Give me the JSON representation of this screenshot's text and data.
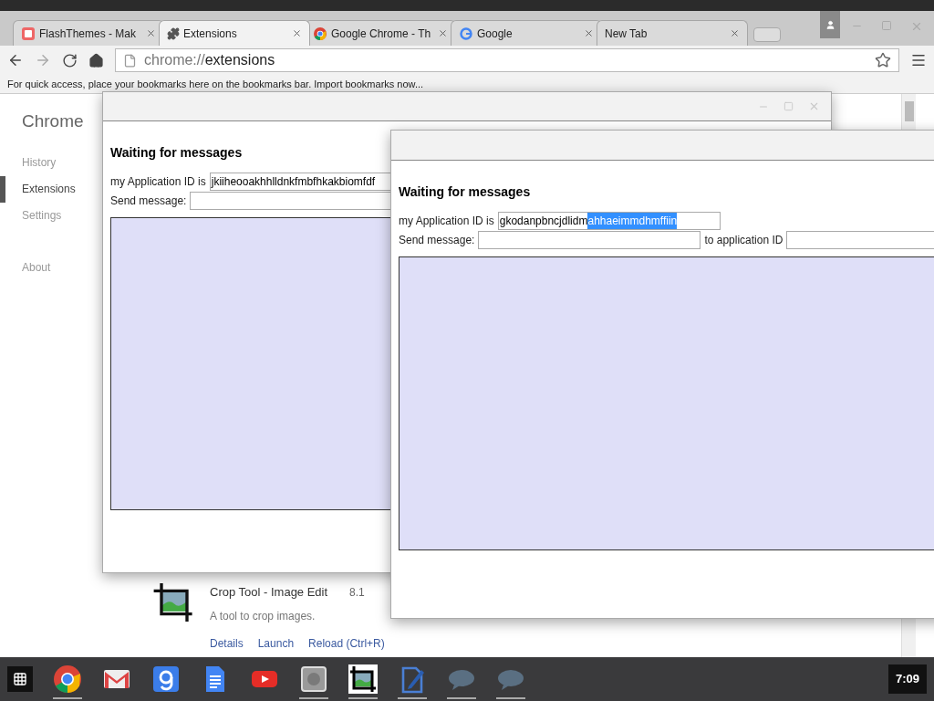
{
  "browser": {
    "tabs": [
      {
        "title": "FlashThemes - Mak",
        "kind": "flashthemes",
        "selected": false
      },
      {
        "title": "Extensions",
        "kind": "puzzle",
        "selected": true
      },
      {
        "title": "Google Chrome - Th",
        "kind": "chrome",
        "selected": false
      },
      {
        "title": "Google",
        "kind": "google",
        "selected": false
      },
      {
        "title": "New Tab",
        "kind": "blank",
        "selected": false
      }
    ],
    "address": {
      "scheme": "chrome://",
      "path": "extensions"
    },
    "bookmarks_bar": "For quick access, place your bookmarks here on the bookmarks bar. Import bookmarks now..."
  },
  "sidebar": {
    "title": "Chrome",
    "items": [
      {
        "label": "History",
        "kind": "main",
        "selected": false
      },
      {
        "label": "Extensions",
        "kind": "main",
        "selected": true
      },
      {
        "label": "Settings",
        "kind": "main",
        "selected": false
      },
      {
        "label": "About",
        "kind": "footer",
        "selected": false
      }
    ]
  },
  "windows": [
    {
      "heading": "Waiting for messages",
      "id_label": "my Application ID is",
      "id_value": "jkiiheooakhhlldnkfmbfhkakbiomfdf",
      "send_label": "Send message:"
    },
    {
      "heading": "Waiting for messages",
      "id_label": "my Application ID is",
      "id_value": "gkodanpbncjdlidm",
      "id_selected_text": "ahhaeimmdhmffiin",
      "send_label": "Send message:",
      "to_label": "to application ID"
    }
  ],
  "extension": {
    "name": "Crop Tool - Image Edit",
    "version": "8.1",
    "description": "A tool to crop images.",
    "links": [
      "Details",
      "Launch",
      "Reload (Ctrl+R)"
    ]
  },
  "taskbar": {
    "apps": [
      {
        "kind": "chrome",
        "running": true
      },
      {
        "kind": "gmail",
        "running": false
      },
      {
        "kind": "google",
        "running": false
      },
      {
        "kind": "docs",
        "running": false
      },
      {
        "kind": "youtube",
        "running": false
      },
      {
        "kind": "files",
        "running": true
      },
      {
        "kind": "crop",
        "running": true
      },
      {
        "kind": "writer",
        "running": true
      },
      {
        "kind": "chat",
        "running": true
      },
      {
        "kind": "chat",
        "running": true
      }
    ],
    "clock": "7:09"
  }
}
